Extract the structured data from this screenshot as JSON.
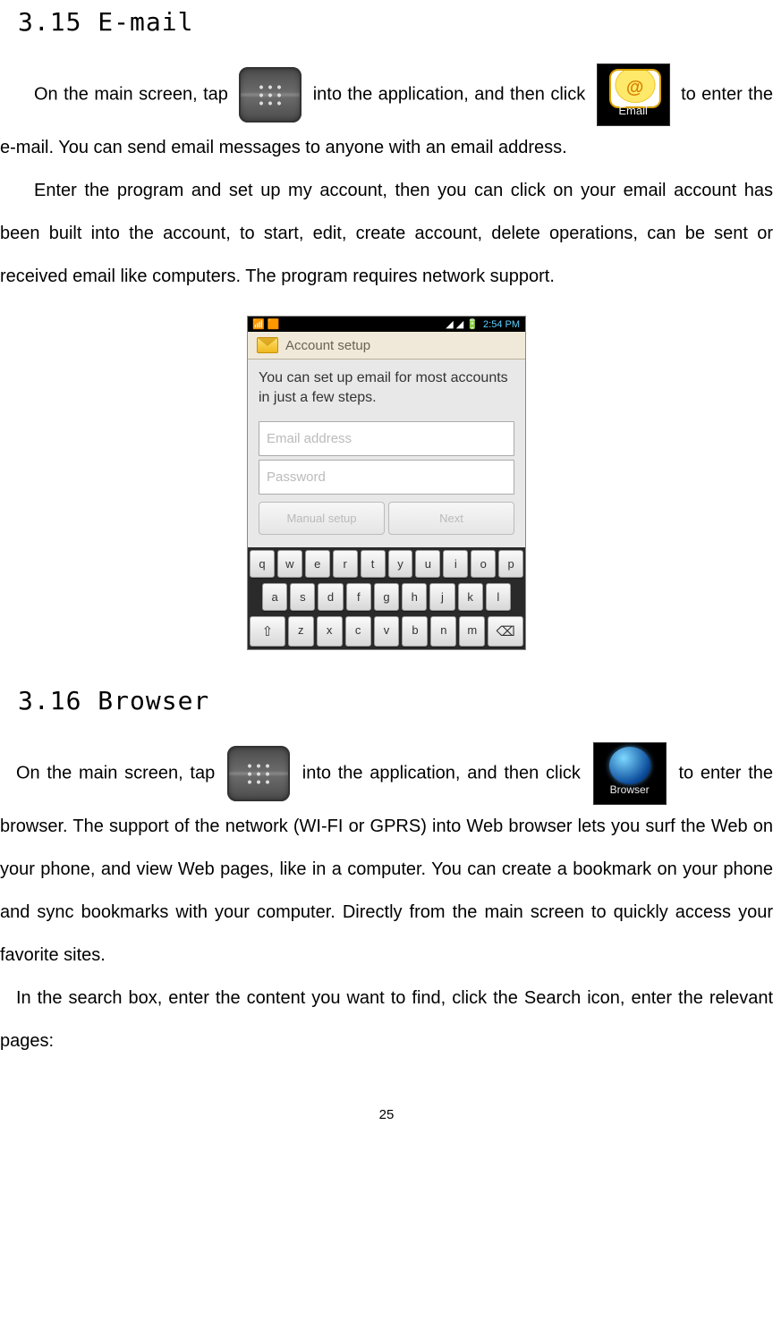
{
  "section1": {
    "heading": "3.15 E-mail"
  },
  "section2": {
    "heading": "3.16 Browser"
  },
  "p1": {
    "t1": "On the main screen, tap ",
    "t2": " into the application, and then click ",
    "t3": " to enter the e-mail. You can send email messages to anyone with an email address."
  },
  "p2": "Enter the program and set up my account, then you can click on your email account has been built into the account, to start, edit, create account, delete operations, can be sent or received email like computers. The program requires network support.",
  "p3": {
    "t1": "On the main screen, tap ",
    "t2": " into the application, and then click ",
    "t3": " to enter the browser. The support of the network (WI-FI or GPRS) into Web browser lets you surf the Web on your phone, and view Web pages, like in a computer. You can create a bookmark on your phone and sync bookmarks with your computer. Directly from the main screen to quickly access your favorite sites."
  },
  "p4": "In the search box, enter the content you want to find, click the Search icon, enter the relevant pages:",
  "email_icon_label": "Email",
  "browser_icon_label": "Browser",
  "screenshot": {
    "status": {
      "left_icons": "📶 🟧",
      "signal": "◢ ◢ 🔋",
      "time": "2:54 PM"
    },
    "header": "Account setup",
    "message": "You can set up email for most accounts in just a few steps.",
    "email_placeholder": "Email address",
    "password_placeholder": "Password",
    "manual_btn": "Manual setup",
    "next_btn": "Next",
    "keys": {
      "r1": [
        "q",
        "w",
        "e",
        "r",
        "t",
        "y",
        "u",
        "i",
        "o",
        "p"
      ],
      "r2": [
        "a",
        "s",
        "d",
        "f",
        "g",
        "h",
        "j",
        "k",
        "l"
      ],
      "r3": [
        "⇧",
        "z",
        "x",
        "c",
        "v",
        "b",
        "n",
        "m",
        "⌫"
      ]
    }
  },
  "page_number": "25"
}
